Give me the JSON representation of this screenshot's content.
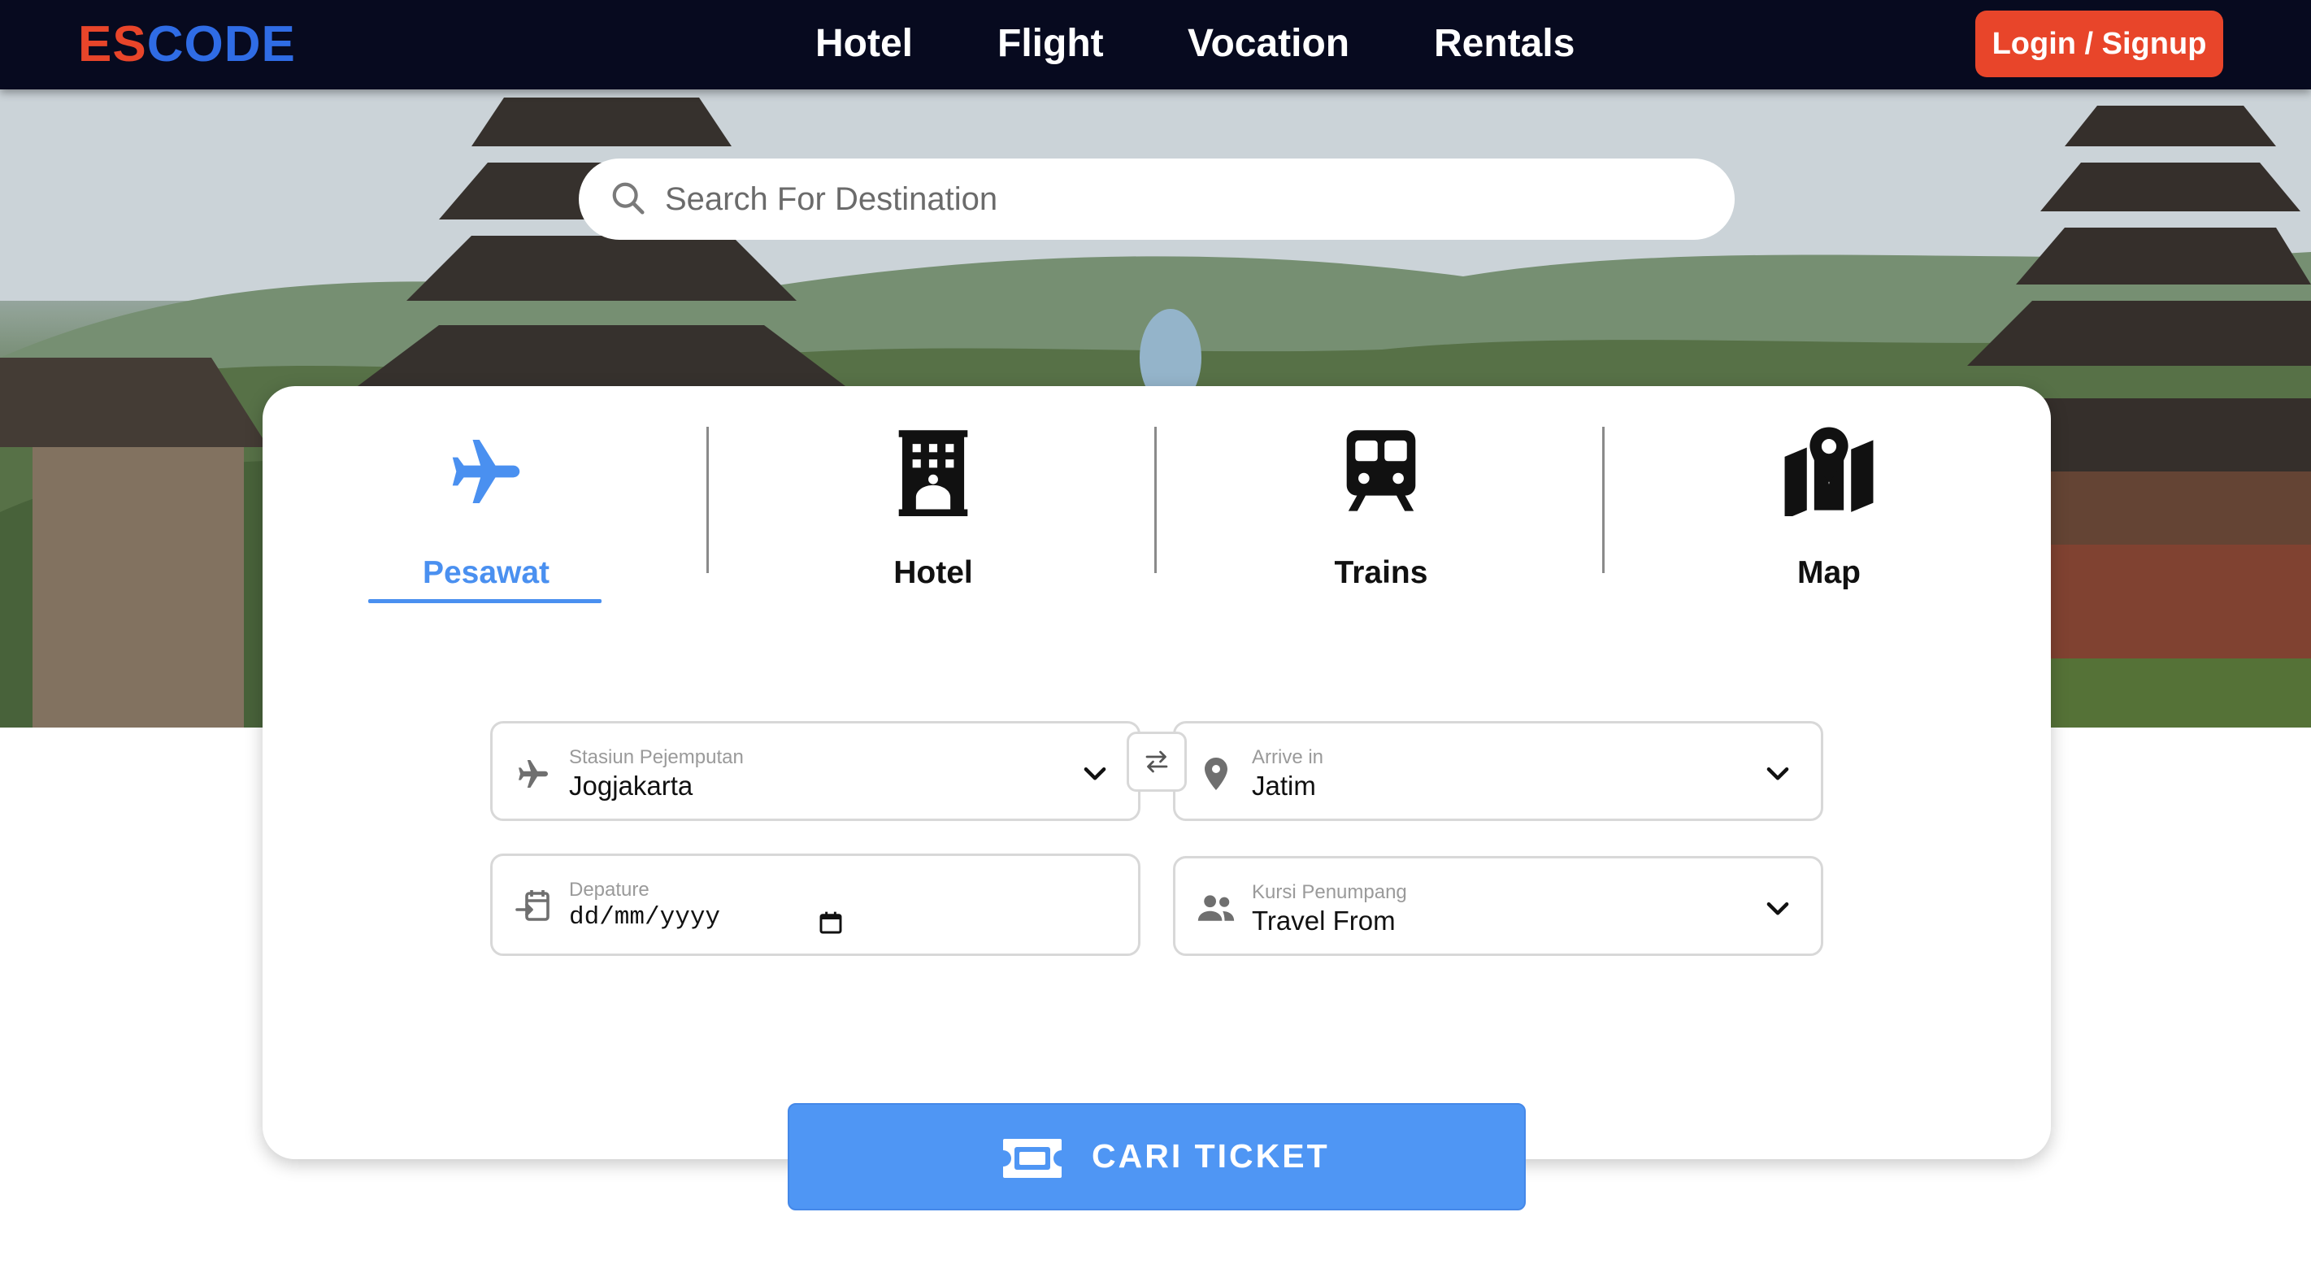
{
  "brand": {
    "part1": "ES",
    "part2": "CODE",
    "color1": "#e8452a",
    "color2": "#2f6ce5"
  },
  "nav": {
    "links": [
      "Hotel",
      "Flight",
      "Vocation",
      "Rentals"
    ],
    "login_label": "Login / Signup"
  },
  "search": {
    "placeholder": "Search For Destination",
    "icon": "search-icon"
  },
  "tabs": [
    {
      "label": "Pesawat",
      "icon": "airplane-icon",
      "active": true
    },
    {
      "label": "Hotel",
      "icon": "hotel-building-icon",
      "active": false
    },
    {
      "label": "Trains",
      "icon": "train-icon",
      "active": false
    },
    {
      "label": "Map",
      "icon": "map-pin-icon",
      "active": false
    }
  ],
  "form": {
    "origin": {
      "label": "Stasiun Pejemputan",
      "value": "Jogjakarta",
      "icon": "airplane-icon"
    },
    "destination": {
      "label": "Arrive in",
      "value": "Jatim",
      "icon": "location-pin-icon"
    },
    "departure": {
      "label": "Depature",
      "placeholder": "dd/mm/yyyy",
      "icon": "calendar-import-icon"
    },
    "passenger": {
      "label": "Kursi Penumpang",
      "value": "Travel From",
      "icon": "people-icon"
    },
    "swap_icon": "swap-arrows-icon"
  },
  "cta": {
    "label": "CARI TICKET",
    "icon": "ticket-icon"
  },
  "colors": {
    "accent": "#4a90f0",
    "nav_bg": "#070a1f",
    "login": "#e8452a",
    "cta": "#4f96f4"
  }
}
